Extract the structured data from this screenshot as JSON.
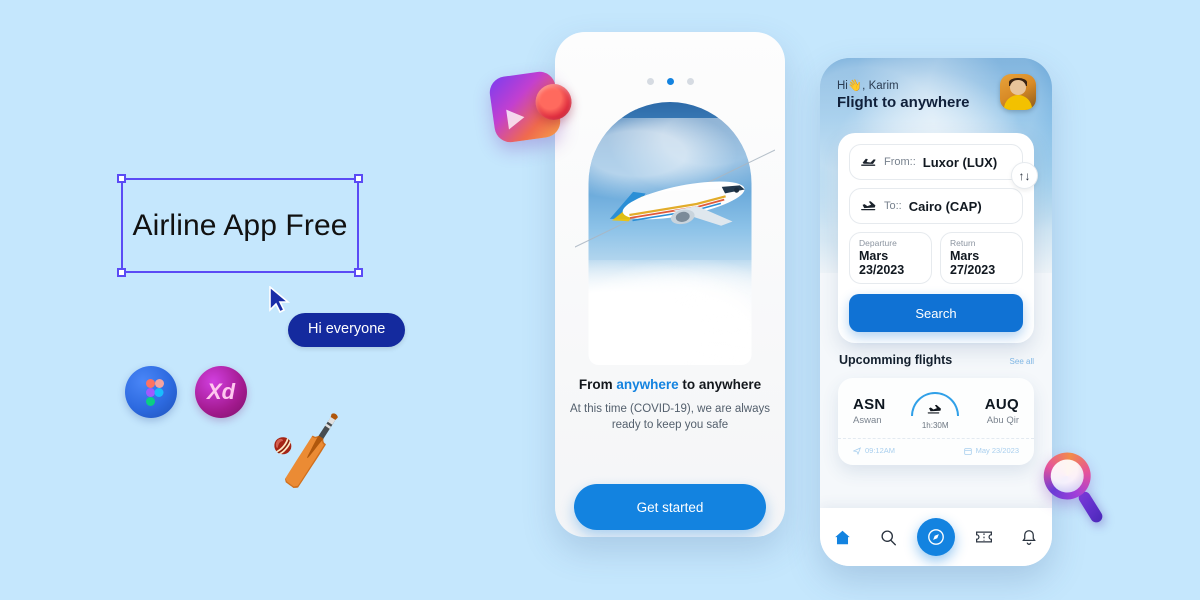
{
  "canvas": {
    "selection": {
      "text": "Airline App Free",
      "frame_color": "#5b4bf5"
    },
    "cursor_label": "Hi everyone",
    "tools": [
      {
        "name": "figma-logo",
        "label": ""
      },
      {
        "name": "adobe-xd-logo",
        "label": "Xd"
      }
    ],
    "emoji": "🏏"
  },
  "onboarding": {
    "dots": [
      {
        "active": false
      },
      {
        "active": true
      },
      {
        "active": false
      }
    ],
    "title_before": "From ",
    "title_highlight": "anywhere",
    "title_after": " to anywhere",
    "subtitle": "At this time (COVID-19), we are always ready to keep you safe",
    "cta_label": "Get started",
    "accent": "#1383e0"
  },
  "booking": {
    "greeting": "Hi👋, Karim",
    "header_title": "Flight to anywhere",
    "search": {
      "from": {
        "label": "From::",
        "value": "Luxor (LUX)",
        "icon": "plane-takeoff-icon"
      },
      "to": {
        "label": "To::",
        "value": "Cairo (CAP)",
        "icon": "plane-landing-icon"
      },
      "swap_glyph": "↑↓",
      "departure": {
        "label": "Departure",
        "value": "Mars 23/2023"
      },
      "return": {
        "label": "Return",
        "value": "Mars 27/2023"
      },
      "button_label": "Search",
      "button_color": "#1072d4"
    },
    "section": {
      "title": "Upcomming flights",
      "see_all": "See all"
    },
    "flight": {
      "origin_code": "ASN",
      "origin_city": "Aswan",
      "destination_code": "AUQ",
      "destination_city": "Abu Qir",
      "duration": "1h:30M",
      "depart_time": "09:12AM",
      "depart_date": "May 23/2023"
    },
    "nav": [
      {
        "name": "home",
        "glyph": "⌂",
        "active": true
      },
      {
        "name": "search",
        "glyph": "⚲",
        "active": false
      },
      {
        "name": "explore",
        "glyph": "⦿",
        "active": false,
        "fab": true
      },
      {
        "name": "tickets",
        "glyph": "⬚",
        "active": false
      },
      {
        "name": "notifications",
        "glyph": "␇",
        "active": false
      }
    ]
  },
  "decor": {
    "camera_icon": "video-camera-3d-icon",
    "magnifier_icon": "magnifier-3d-icon"
  },
  "background_color": "#c5e7fd"
}
